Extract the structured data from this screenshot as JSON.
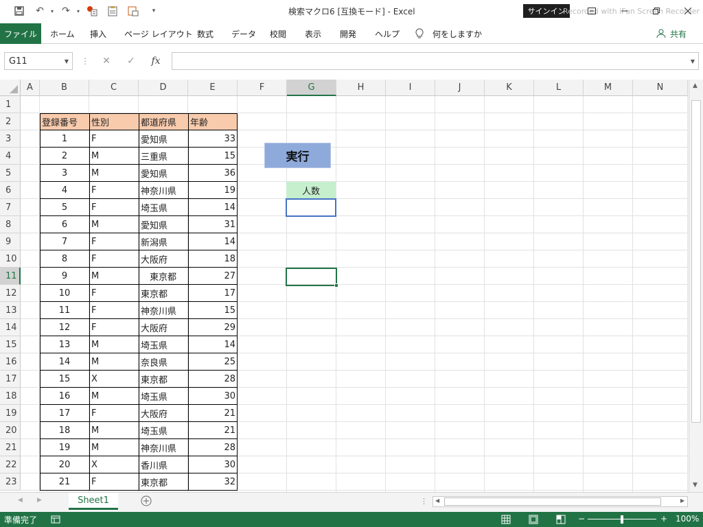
{
  "window": {
    "title": "検索マクロ6 [互換モード] - Excel",
    "signin_label": "サインイン",
    "watermark": "Recorded with iFun Screen Recorder"
  },
  "ribbon": {
    "tabs": [
      "ファイル",
      "ホーム",
      "挿入",
      "ページ レイアウト",
      "数式",
      "データ",
      "校閲",
      "表示",
      "開発",
      "ヘルプ"
    ],
    "tell_me": "何をしますか",
    "share": "共有"
  },
  "formula_bar": {
    "name_box": "G11",
    "fx_label": "fx",
    "formula": ""
  },
  "grid": {
    "columns": [
      "A",
      "B",
      "C",
      "D",
      "E",
      "F",
      "G",
      "H",
      "I",
      "J",
      "K",
      "L",
      "M",
      "N"
    ],
    "selected_column": "G",
    "rows": [
      "1",
      "2",
      "3",
      "4",
      "5",
      "6",
      "7",
      "8",
      "9",
      "10",
      "11",
      "12",
      "13",
      "14",
      "15",
      "16",
      "17",
      "18",
      "19",
      "20",
      "21",
      "22",
      "23"
    ],
    "selected_row": "11"
  },
  "table": {
    "headers": [
      "登録番号",
      "性別",
      "都道府県",
      "年齢"
    ],
    "rows": [
      [
        "1",
        "F",
        "愛知県",
        "33"
      ],
      [
        "2",
        "M",
        "三重県",
        "15"
      ],
      [
        "3",
        "M",
        "愛知県",
        "36"
      ],
      [
        "4",
        "F",
        "神奈川県",
        "19"
      ],
      [
        "5",
        "F",
        "埼玉県",
        "14"
      ],
      [
        "6",
        "M",
        "愛知県",
        "31"
      ],
      [
        "7",
        "F",
        "新潟県",
        "14"
      ],
      [
        "8",
        "F",
        "大阪府",
        "18"
      ],
      [
        "9",
        "M",
        "　東京都",
        "27"
      ],
      [
        "10",
        "F",
        "東京都",
        "17"
      ],
      [
        "11",
        "F",
        "神奈川県",
        "15"
      ],
      [
        "12",
        "F",
        "大阪府",
        "29"
      ],
      [
        "13",
        "M",
        "埼玉県",
        "14"
      ],
      [
        "14",
        "M",
        "奈良県",
        "25"
      ],
      [
        "15",
        "X",
        "東京都",
        "28"
      ],
      [
        "16",
        "M",
        "埼玉県",
        "30"
      ],
      [
        "17",
        "F",
        "大阪府",
        "21"
      ],
      [
        "18",
        "M",
        "埼玉県",
        "21"
      ],
      [
        "19",
        "M",
        "神奈川県",
        "28"
      ],
      [
        "20",
        "X",
        "香川県",
        "30"
      ],
      [
        "21",
        "F",
        "東京都",
        "32"
      ]
    ]
  },
  "run_button": {
    "label": "実行"
  },
  "count_label": "人数",
  "sheets": {
    "active": "Sheet1"
  },
  "status": {
    "ready": "準備完了",
    "zoom": "100%",
    "zoom_minus": "−",
    "zoom_plus": "+"
  },
  "colors": {
    "accent": "#217346",
    "header_fill": "#f8cbad",
    "button_fill": "#8eaadb",
    "label_fill": "#c6efce"
  }
}
